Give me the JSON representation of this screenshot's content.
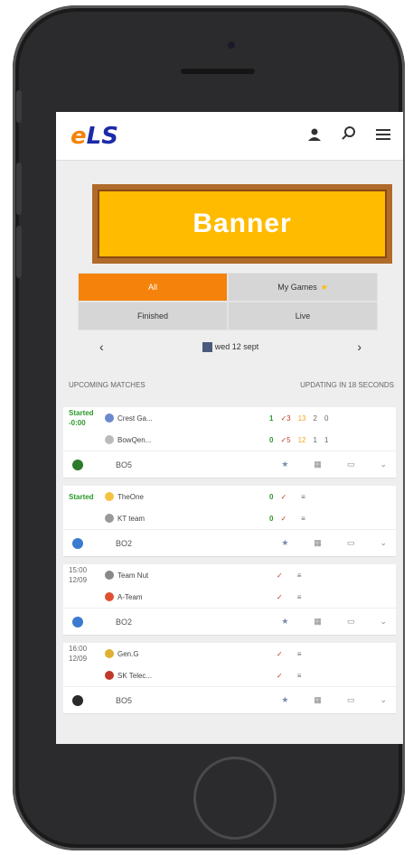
{
  "header": {
    "logo_e": "e",
    "logo_ls": "LS",
    "icons": [
      "user-icon",
      "search-icon",
      "menu-icon"
    ]
  },
  "banner": {
    "label": "Banner"
  },
  "tabs": [
    {
      "label": "All",
      "active": true
    },
    {
      "label": "My Games",
      "active": false
    },
    {
      "label": "Finished",
      "active": false
    },
    {
      "label": "Live",
      "active": false
    }
  ],
  "datenav": {
    "prev": "‹",
    "next": "›",
    "date": "wed 12 sept"
  },
  "section": {
    "left": "UPCOMING MATCHES",
    "right": "UPDATING IN 18 SECONDS"
  },
  "matches": [
    {
      "time": "Started\n-0:00",
      "started": true,
      "team1": "Crest Ga...",
      "team2": "BowQen...",
      "stats1": [
        "1",
        "✓3",
        "13",
        "2",
        "0"
      ],
      "stats2": [
        "0",
        "✓5",
        "12",
        "1",
        "1"
      ],
      "bo": "BO5"
    },
    {
      "time": "Started",
      "started": true,
      "team1": "TheOne",
      "team2": "KT team",
      "stats1": [
        "0",
        "✓",
        "",
        "≡",
        ""
      ],
      "stats2": [
        "0",
        "✓",
        "",
        "≡",
        ""
      ],
      "bo": "BO2"
    },
    {
      "time": "15:00\n12/09",
      "started": false,
      "team1": "Team Nut",
      "team2": "A-Team",
      "stats1": [
        "",
        "✓",
        "",
        "≡",
        ""
      ],
      "stats2": [
        "",
        "✓",
        "",
        "≡",
        ""
      ],
      "bo": "BO2"
    },
    {
      "time": "16:00\n12/09",
      "started": false,
      "team1": "Gen.G",
      "team2": "SK Telec...",
      "stats1": [
        "",
        "✓",
        "",
        "≡",
        ""
      ],
      "stats2": [
        "",
        "✓",
        "",
        "≡",
        ""
      ],
      "bo": "BO5"
    }
  ],
  "colors": {
    "brand_orange": "#f5820a",
    "brand_blue": "#1a2aa8",
    "banner": "#ffbb00",
    "started": "#2a9a2a"
  }
}
